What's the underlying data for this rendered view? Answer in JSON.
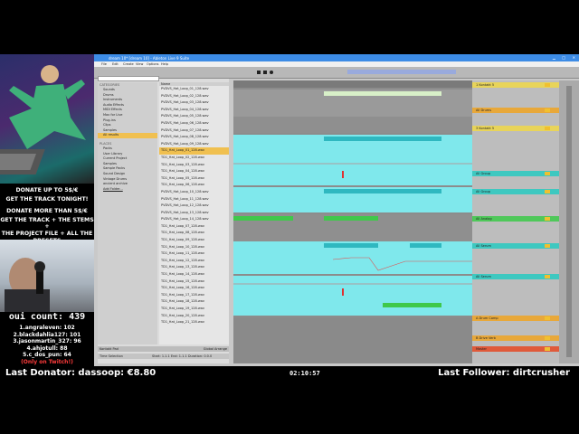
{
  "stream": {
    "donate_line1": "DONATE UP TO 5$/€",
    "donate_line2": "GET THE TRACK TONIGHT!",
    "donate_line3": "DONATE MORE THAN 5$/€",
    "donate_line4": "GET THE TRACK + THE STEMS +",
    "donate_line5": "THE PROJECT FILE + ALL THE",
    "donate_line6": "PRESETS",
    "oui_count": "oui count: 439",
    "leaderboard": [
      "1.angraleven: 102",
      "2.blackdahlia127: 101",
      "3.jasonmartin_327: 96",
      "4.ahjotull: 88",
      "5.c_dos_pun: 64"
    ],
    "twitch_note": "(Only on Twitch!)",
    "last_donator": "Last Donator: dassoop: €8.80",
    "timer": "02:10:57",
    "last_follower": "Last Follower: dirtcrusher"
  },
  "live": {
    "title": "dream 10* [dream 10] - Ableton Live 9 Suite",
    "menu": [
      "File",
      "Edit",
      "Create",
      "View",
      "Options",
      "Help"
    ],
    "search_placeholder": "Search",
    "places": [
      "Sounds",
      "Drums",
      "Instruments",
      "Audio Effects",
      "MIDI Effects",
      "Max for Live",
      "Plug-ins",
      "Clips",
      "Samples",
      "All results"
    ],
    "places_header": "CATEGORIES",
    "places2_header": "PLACES",
    "places2": [
      "Packs",
      "User Library",
      "Current Project",
      "Samples",
      "Sample Packs",
      "Sound Design",
      "Vintage Drums",
      "ancient archive",
      "Add Folder..."
    ],
    "files_header": "Name",
    "files": [
      "PVDVS_Hat_Loop_01_128.wav",
      "PVDVS_Hat_Loop_02_128.wav",
      "PVDVS_Hat_Loop_03_128.wav",
      "PVDVS_Hat_Loop_04_128.wav",
      "PVDVS_Hat_Loop_05_128.wav",
      "PVDVS_Hat_Loop_06_128.wav",
      "PVDVS_Hat_Loop_07_128.wav",
      "PVDVS_Hat_Loop_08_128.wav",
      "PVDVS_Hat_Loop_09_128.wav",
      "TD1_Hat_Loop_01_128.wav",
      "TD1_Hat_Loop_02_128.wav",
      "TD1_Hat_Loop_03_128.wav",
      "TD1_Hat_Loop_04_128.wav",
      "TD1_Hat_Loop_05_128.wav",
      "TD1_Hat_Loop_06_128.wav",
      "PVDVS_Hat_Loop_10_128.wav",
      "PVDVS_Hat_Loop_11_128.wav",
      "PVDVS_Hat_Loop_12_128.wav",
      "PVDVS_Hat_Loop_13_128.wav",
      "PVDVS_Hat_Loop_14_128.wav",
      "TD1_Hat_Loop_07_128.wav",
      "TD1_Hat_Loop_08_128.wav",
      "TD1_Hat_Loop_09_128.wav",
      "TD1_Hat_Loop_10_128.wav",
      "TD1_Hat_Loop_11_128.wav",
      "TD1_Hat_Loop_12_128.wav",
      "TD1_Hat_Loop_13_128.wav",
      "TD1_Hat_Loop_14_128.wav",
      "TD1_Hat_Loop_15_128.wav",
      "TD1_Hat_Loop_16_128.wav",
      "TD1_Hat_Loop_17_128.wav",
      "TD1_Hat_Loop_18_128.wav",
      "TD1_Hat_Loop_19_128.wav",
      "TD1_Hat_Loop_20_128.wav",
      "TD1_Hat_Loop_21_128.wav"
    ],
    "tracks": [
      {
        "name": "1 Kontakt 5",
        "color": "#e8d45a"
      },
      {
        "name": "All Drums",
        "color": "#e8a83a"
      },
      {
        "name": "3 Kontakt 5",
        "color": "#e8d45a"
      },
      {
        "name": "All Group",
        "color": "#3ec8c0"
      },
      {
        "name": "All Group",
        "color": "#3ec8c0"
      },
      {
        "name": "All Analog",
        "color": "#4fc85a"
      },
      {
        "name": "All Serum",
        "color": "#3ec8c0"
      },
      {
        "name": "All Serum",
        "color": "#3ec8c0"
      },
      {
        "name": "A Drum Comp",
        "color": "#e8a83a"
      },
      {
        "name": "B Drive Verb",
        "color": "#e8a83a"
      },
      {
        "name": "Master",
        "color": "#e05a3a"
      }
    ],
    "status_left": "Time Selection",
    "status_right": "Start: 1.1.1   End: 1.1.1   Duration: 0.0.0",
    "bottom_track": "Kontakt Pad",
    "bottom_right": "Global Arrange"
  }
}
